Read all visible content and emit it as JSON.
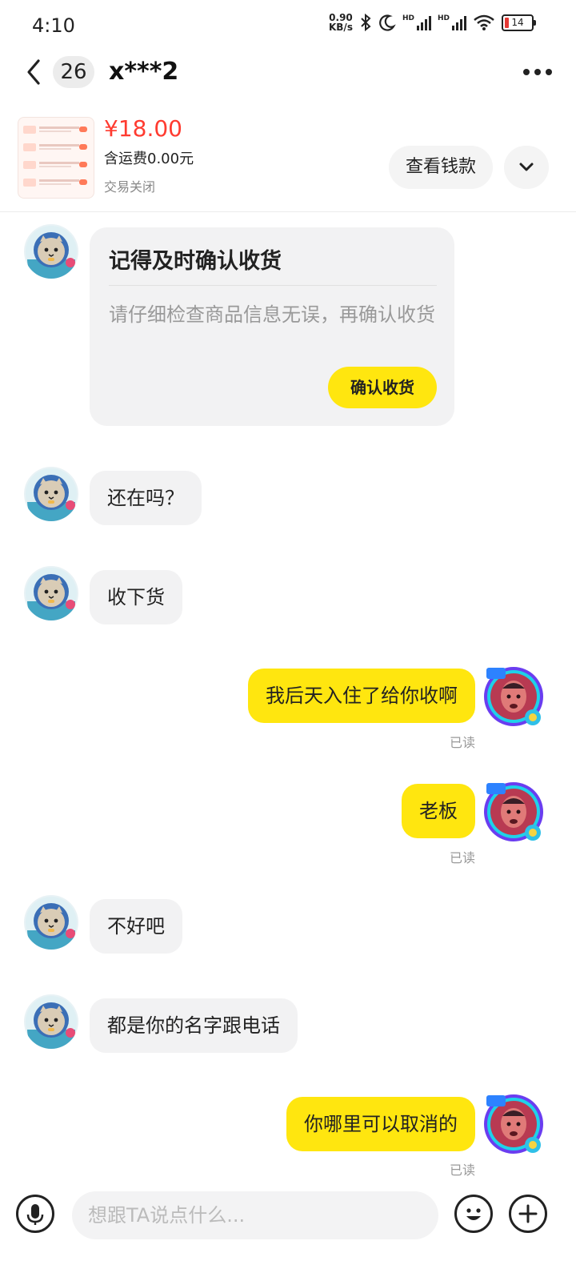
{
  "status_bar": {
    "time": "4:10",
    "net_speed_value": "0.90",
    "net_speed_unit": "KB/s",
    "battery": "14"
  },
  "header": {
    "unread_count": "26",
    "title": "x***2"
  },
  "product": {
    "price": "¥18.00",
    "shipping": "含运费0.00元",
    "trade_status": "交易关闭",
    "view_button": "查看钱款"
  },
  "system_card": {
    "title": "记得及时确认收货",
    "description": "请仔细检查商品信息无误，再确认收货",
    "button": "确认收货"
  },
  "messages": [
    {
      "side": "left",
      "text": "还在吗？"
    },
    {
      "side": "left",
      "text": "收下货"
    },
    {
      "side": "right",
      "text": "我后天入住了给你收啊",
      "status": "已读"
    },
    {
      "side": "right",
      "text": "老板",
      "status": "已读"
    },
    {
      "side": "left",
      "text": "不好吧"
    },
    {
      "side": "left",
      "text": "都是你的名字跟电话"
    },
    {
      "side": "right",
      "text": "你哪里可以取消的",
      "status": "已读"
    }
  ],
  "input": {
    "placeholder": "想跟TA说点什么..."
  },
  "colors": {
    "accent_yellow": "#ffe60f",
    "price_red": "#ff3b30",
    "bubble_gray": "#f2f2f3"
  }
}
